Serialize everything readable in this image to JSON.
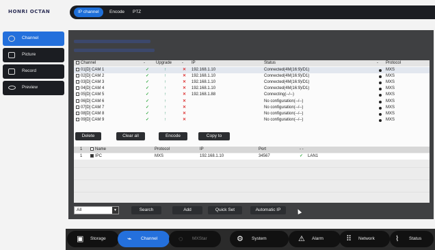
{
  "brand": {
    "logo_text": "HONRI OCTAN"
  },
  "top_tabs": [
    {
      "label": "IP channel",
      "active": true
    },
    {
      "label": "Encode",
      "active": false
    },
    {
      "label": "PTZ",
      "active": false
    }
  ],
  "sidebar": {
    "items": [
      {
        "label": "Channel",
        "icon": "channel-icon",
        "active": true
      },
      {
        "label": "Picture",
        "icon": "picture-icon",
        "active": false
      },
      {
        "label": "Record",
        "icon": "record-icon",
        "active": false
      },
      {
        "label": "Preview",
        "icon": "preview-icon",
        "active": false
      }
    ]
  },
  "channel_table": {
    "headers": {
      "channel": "Channel",
      "dash1": "-",
      "upgrade": "Upgrade",
      "dash2": "-",
      "ip": "IP",
      "status": "Status",
      "dash3": "-",
      "protocol": "Protocol"
    },
    "rows": [
      {
        "channel": "01[D] CAM 1",
        "ip": "192.168.1.10",
        "status": "Connected(4M(16:9)/D1)",
        "protocol": "MXS",
        "online": true
      },
      {
        "channel": "02[D] CAM 2",
        "ip": "192.168.1.10",
        "status": "Connected(4M(16:9)/D1)",
        "protocol": "MXS",
        "online": true
      },
      {
        "channel": "03[D] CAM 3",
        "ip": "192.168.1.10",
        "status": "Connected(4M(16:9)/D1)",
        "protocol": "MXS",
        "online": true
      },
      {
        "channel": "04[D] CAM 4",
        "ip": "192.168.1.10",
        "status": "Connected(4M(16:9)/D1)",
        "protocol": "MXS",
        "online": true
      },
      {
        "channel": "05[D] CAM 5",
        "ip": "192.168.1.88",
        "status": "Connecting(--/--)",
        "protocol": "MXS",
        "online": true
      },
      {
        "channel": "06[D] CAM 6",
        "ip": "",
        "status": "No configuration(--/--)",
        "protocol": "MXS",
        "online": false
      },
      {
        "channel": "07[D] CAM 7",
        "ip": "",
        "status": "No configuration(--/--)",
        "protocol": "MXS",
        "online": false
      },
      {
        "channel": "08[D] CAM 8",
        "ip": "",
        "status": "No configuration(--/--)",
        "protocol": "MXS",
        "online": false
      },
      {
        "channel": "09[D] CAM 9",
        "ip": "",
        "status": "No configuration(--/--)",
        "protocol": "MXS",
        "online": false
      }
    ]
  },
  "channel_buttons": {
    "delete": "Delete",
    "clear_all": "Clear all",
    "encode": "Encode",
    "copy_to": "Copy to"
  },
  "device_table": {
    "headers": {
      "num": "1",
      "name": "Name",
      "protocol": "Protocol",
      "ip": "IP",
      "port": "Port",
      "extra": "- -"
    },
    "rows": [
      {
        "num": "1",
        "name": "IPC",
        "protocol": "MXS",
        "ip": "192.168.1.10",
        "port": "34567",
        "lan": "LAN1"
      }
    ]
  },
  "search_controls": {
    "filter_value": "All",
    "search": "Search",
    "add": "Add",
    "quick_set": "Quick Set",
    "automatic_ip": "Automatic IP"
  },
  "bottom_nav": [
    {
      "label": "Storage",
      "icon": "storage-icon",
      "active": false
    },
    {
      "label": "Channel",
      "icon": "channel-icon",
      "active": true
    },
    {
      "label": "MXStar",
      "icon": "mxstar-icon",
      "active": false,
      "dim": true
    },
    {
      "label": "System",
      "icon": "system-gear-icon",
      "active": false
    },
    {
      "label": "Alarm",
      "icon": "alarm-icon",
      "active": false
    },
    {
      "label": "Network",
      "icon": "network-icon",
      "active": false
    },
    {
      "label": "Status",
      "icon": "status-icon",
      "active": false
    }
  ],
  "colors": {
    "accent": "#2470dc",
    "panel": "#3f4042",
    "dark": "#1b1d22",
    "check": "#2aa53a",
    "cross": "#dd3333"
  }
}
